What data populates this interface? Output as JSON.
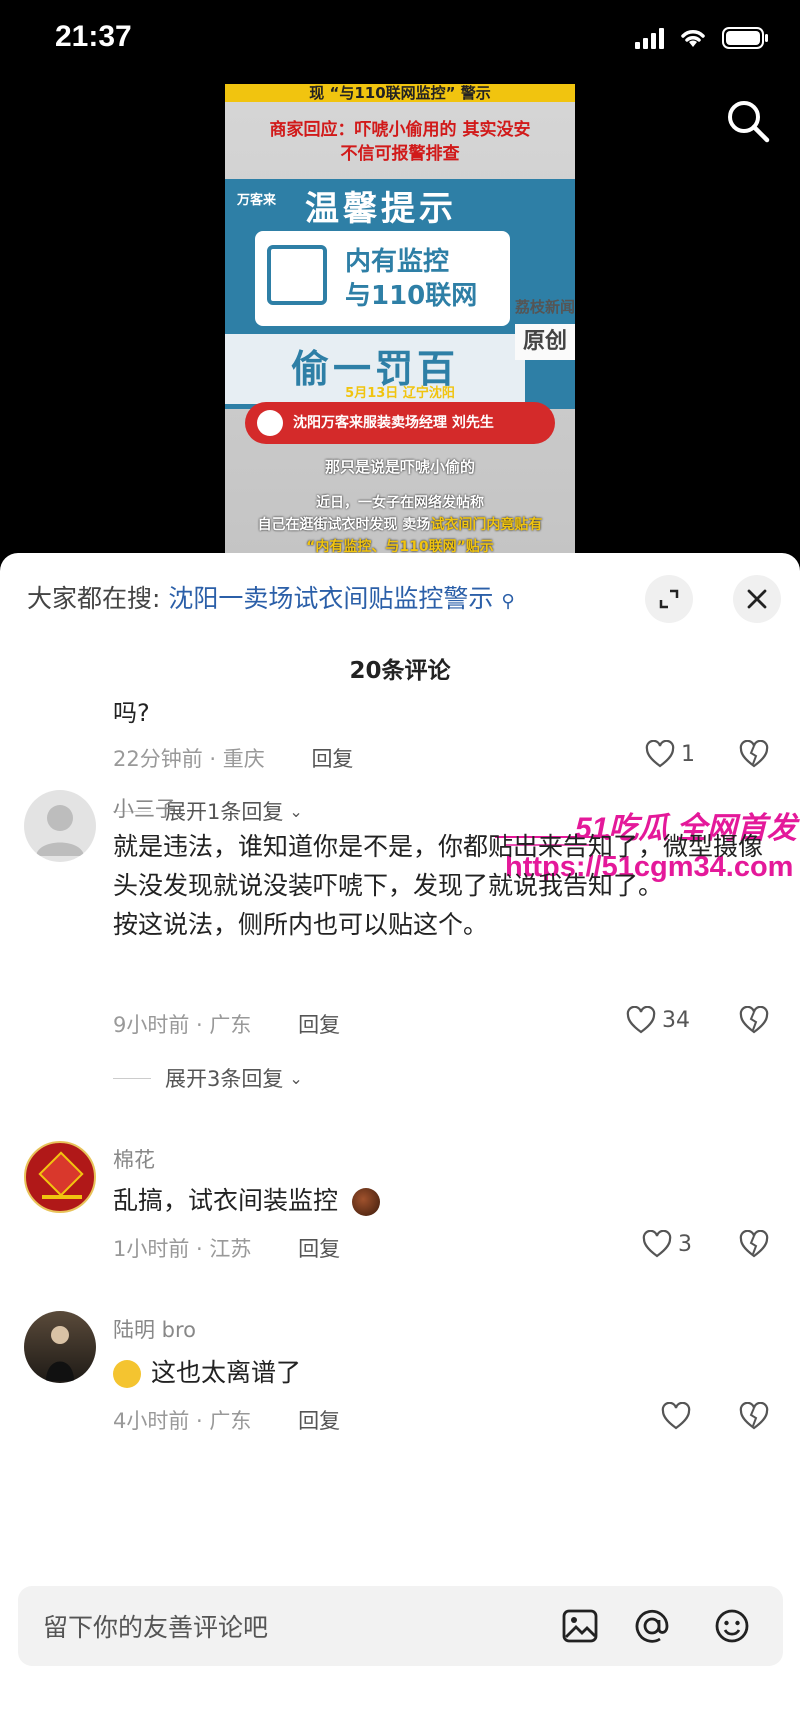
{
  "status_bar": {
    "time": "21:37"
  },
  "video": {
    "top_banner": "现 “与110联网监控” 警示",
    "red_line1": "商家回应：吓唬小偷用的 其实没安",
    "red_line2": "不信可报警排查",
    "brand": "万客来",
    "sign_title": "温馨提示",
    "sign_line1": "内有监控",
    "sign_line2": "与110联网",
    "sign_penalty": "偷一罚百",
    "source": "荔枝新闻",
    "original_badge": "原创",
    "date_location": "5月13日 辽宁沈阳",
    "speaker": "沈阳万客来服装卖场经理 刘先生",
    "subtitle": "那只是说是吓唬小偷的",
    "caption_line1": "近日，一女子在网络发帖称",
    "caption_line2_pre": "自己在逛街试衣时发现 卖场",
    "caption_line2_hl": "试衣间门内竟贴有",
    "caption_line3": "“内有监控、与110联网”贴示"
  },
  "sheet": {
    "hot_search_prefix": "大家都在搜:",
    "hot_search_link": "沈阳一卖场试衣间贴监控警示",
    "comment_count": "20条评论"
  },
  "comments": [
    {
      "text": "吗?",
      "time_location": "22分钟前 · 重庆",
      "reply": "回复",
      "likes": "1",
      "expand": "展开1条回复"
    },
    {
      "username": "小三子",
      "text_line1": "就是违法，谁知道你是不是，你都贴出来告知了，微型摄像头没发现就说没装吓唬下，发现了就说我告知了。",
      "text_line2": "按这说法，侧所内也可以贴这个。",
      "time_location": "9小时前 · 广东",
      "reply": "回复",
      "likes": "34",
      "expand": "展开3条回复"
    },
    {
      "username": "棉花",
      "text": "乱搞，试衣间装监控",
      "time_location": "1小时前 · 江苏",
      "reply": "回复",
      "likes": "3"
    },
    {
      "username": "陆明 bro",
      "text": "这也太离谱了",
      "time_location": "4小时前 · 广东",
      "reply": "回复",
      "likes": ""
    }
  ],
  "watermark": {
    "line1": "51吃瓜 全网首发",
    "line2": "https://51cgm34.com"
  },
  "input": {
    "placeholder": "留下你的友善评论吧"
  },
  "colors": {
    "accent_link": "#2b5fa8",
    "watermark": "#e4199a",
    "sign_blue": "#2e7fa6"
  }
}
